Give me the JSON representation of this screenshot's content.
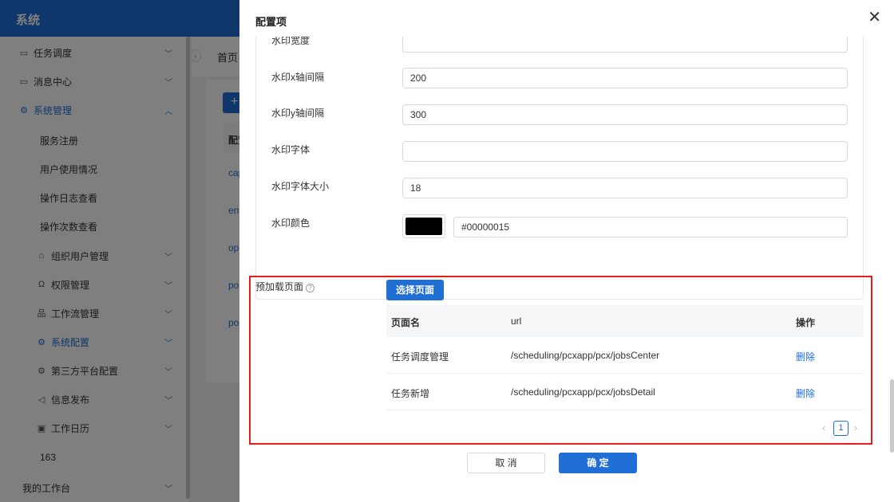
{
  "app": {
    "title": "系统",
    "breadcrumb": "首页",
    "table_header_peek": "配置",
    "table_links_peek": [
      "cap",
      "ent",
      "op",
      "po",
      "po"
    ]
  },
  "sidebar": {
    "items": [
      {
        "label": "任务调度",
        "icon": "folder-icon",
        "expanded": false
      },
      {
        "label": "消息中心",
        "icon": "folder-icon",
        "expanded": false
      },
      {
        "label": "系统管理",
        "icon": "gear-icon",
        "expanded": true,
        "active": true
      },
      {
        "label": "服务注册"
      },
      {
        "label": "用户使用情况"
      },
      {
        "label": "操作日志查看"
      },
      {
        "label": "操作次数查看"
      },
      {
        "label": "组织用户管理",
        "icon": "bank-icon"
      },
      {
        "label": "权限管理",
        "icon": "user-icon"
      },
      {
        "label": "工作流管理",
        "icon": "flow-icon"
      },
      {
        "label": "系统配置",
        "icon": "gear-icon",
        "active": true
      },
      {
        "label": "第三方平台配置",
        "icon": "gear-icon"
      },
      {
        "label": "信息发布",
        "icon": "speaker-icon"
      },
      {
        "label": "工作日历",
        "icon": "calendar-icon"
      },
      {
        "label": "163"
      },
      {
        "label": "我的工作台"
      }
    ]
  },
  "drawer": {
    "title": "配置项",
    "close_symbol": "✕",
    "fields": [
      {
        "label": "水印宽度",
        "value": ""
      },
      {
        "label": "水印x轴间隔",
        "value": "200"
      },
      {
        "label": "水印y轴间隔",
        "value": "300"
      },
      {
        "label": "水印字体",
        "value": ""
      },
      {
        "label": "水印字体大小",
        "value": "18"
      },
      {
        "label": "水印颜色",
        "value": "#00000015"
      }
    ],
    "preload": {
      "label": "预加载页面",
      "select_button": "选择页面",
      "columns": {
        "name": "页面名",
        "url": "url",
        "action": "操作"
      },
      "rows": [
        {
          "name": "任务调度管理",
          "url": "/scheduling/pcxapp/pcx/jobsCenter",
          "action": "删除"
        },
        {
          "name": "任务新增",
          "url": "/scheduling/pcxapp/pcx/jobsDetail",
          "action": "删除"
        }
      ],
      "pagination": {
        "current": "1",
        "prev": "‹",
        "next": "›"
      }
    },
    "footer": {
      "cancel": "取 消",
      "ok": "确 定"
    }
  },
  "colors": {
    "primary": "#1f6fd6",
    "highlight": "#e81c1c",
    "swatch": "#000000"
  }
}
